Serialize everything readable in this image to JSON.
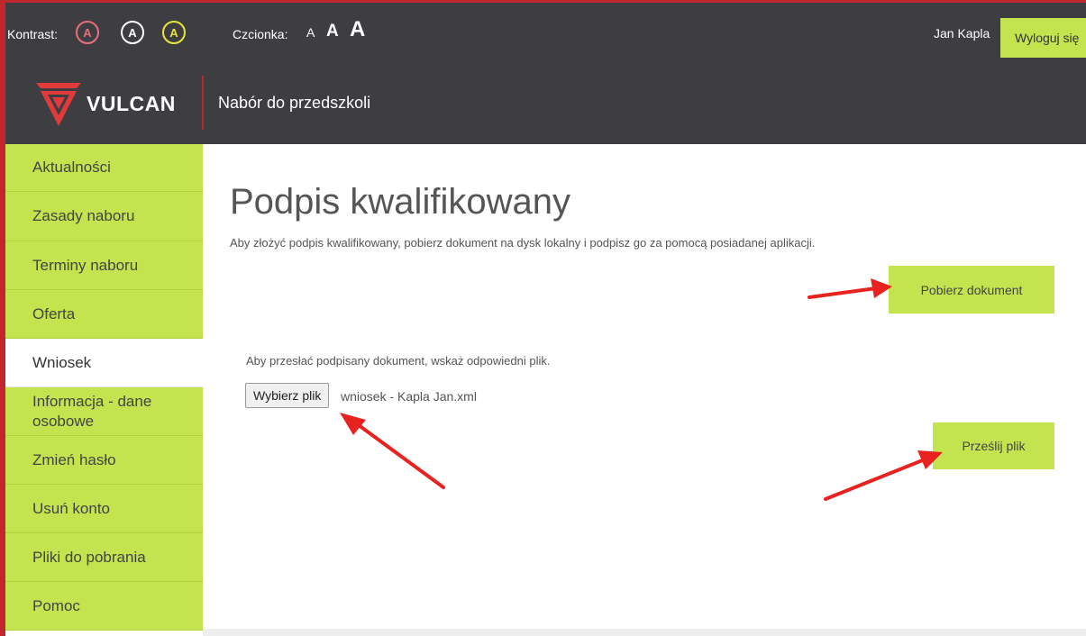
{
  "topbar": {
    "contrast_label": "Kontrast:",
    "contrast_options": [
      "A",
      "A",
      "A"
    ],
    "font_label": "Czcionka:",
    "font_sizes": [
      "A",
      "A",
      "A"
    ],
    "username": "Jan Kapla",
    "logout_label": "Wyloguj się"
  },
  "header": {
    "logo_text": "VULCAN",
    "app_title": "Nabór do przedszkoli"
  },
  "sidebar": {
    "items": [
      {
        "label": "Aktualności",
        "active": false
      },
      {
        "label": "Zasady naboru",
        "active": false
      },
      {
        "label": "Terminy naboru",
        "active": false
      },
      {
        "label": "Oferta",
        "active": false
      },
      {
        "label": "Wniosek",
        "active": true
      },
      {
        "label": "Informacja - dane osobowe",
        "active": false
      },
      {
        "label": "Zmień hasło",
        "active": false
      },
      {
        "label": "Usuń konto",
        "active": false
      },
      {
        "label": "Pliki do pobrania",
        "active": false
      },
      {
        "label": "Pomoc",
        "active": false
      }
    ]
  },
  "main": {
    "title": "Podpis kwalifikowany",
    "description": "Aby złożyć podpis kwalifikowany, pobierz dokument na dysk lokalny i podpisz go za pomocą posiadanej aplikacji.",
    "download_button": "Pobierz dokument",
    "upload_description": "Aby przesłać podpisany dokument, wskaż odpowiedni plik.",
    "choose_file_button": "Wybierz plik",
    "chosen_file_name": "wniosek - Kapla Jan.xml",
    "send_button": "Prześlij plik"
  },
  "colors": {
    "accent_green": "#c3e34f",
    "dark_header": "#3e3e42",
    "brand_red": "#c0262b",
    "annotation_arrow": "#e8221e"
  }
}
